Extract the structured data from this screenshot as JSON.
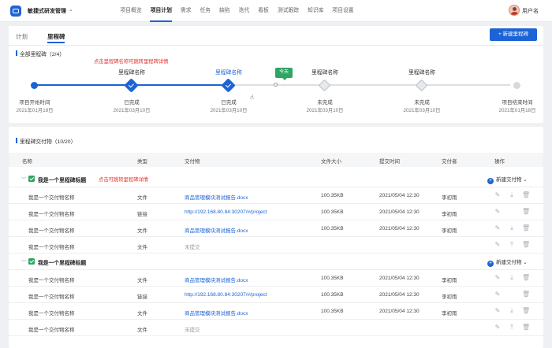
{
  "app": {
    "title": "敏捷式研发管理",
    "username": "用户名"
  },
  "nav": [
    "项目概览",
    "项目计划",
    "需求",
    "任务",
    "缺陷",
    "迭代",
    "看板",
    "测试跟踪",
    "知识库",
    "项目设置"
  ],
  "tabs": {
    "plan": "计划",
    "milestone": "里程碑"
  },
  "new_milestone_button": "+ 新建里程碑",
  "milestones_section": {
    "title": "全部里程碑（2/4）",
    "annotation": "点击里程碑名称可跳转里程碑详情",
    "today_label": "今天",
    "nodes": [
      {
        "name": "",
        "status": "项目开始时间",
        "date": "2021年01月18日"
      },
      {
        "name": "里程碑名称",
        "status": "已完成",
        "date": "2021年03月10日"
      },
      {
        "name": "里程碑名称",
        "status": "已完成",
        "date": "2021年03月10日"
      },
      {
        "name": "里程碑名称",
        "status": "未完成",
        "date": "2021年03月10日"
      },
      {
        "name": "里程碑名称",
        "status": "未完成",
        "date": "2021年03月10日"
      },
      {
        "name": "",
        "status": "项目结束时间",
        "date": "2021年01月18日"
      }
    ]
  },
  "deliverables_section": {
    "title": "里程碑交付物（10/20）",
    "columns": [
      "名称",
      "类型",
      "交付物",
      "文件大小",
      "提交时间",
      "交付者",
      "操作"
    ],
    "group_annotation": "点击可跳转里程碑详情",
    "new_deliverable": "新建交付物",
    "groups": [
      {
        "title": "我是一个里程碑标题",
        "rows": [
          {
            "name": "我是一个交付物名称",
            "type": "文件",
            "item": "商品管理模块测试报告.docx",
            "size": "100.35KB",
            "time": "2021/05/04 12:30",
            "by": "李初雨"
          },
          {
            "name": "我是一个交付物名称",
            "type": "链接",
            "item": "http://192.168.80.84:30207/#/project",
            "size": "100.35KB",
            "time": "2021/05/04 12:30",
            "by": "李初雨"
          },
          {
            "name": "我是一个交付物名称",
            "type": "文件",
            "item": "商品管理模块测试报告.docx",
            "size": "100.35KB",
            "time": "2021/05/04 12:30",
            "by": "李初雨"
          },
          {
            "name": "我是一个交付物名称",
            "type": "文件",
            "item": "未提交",
            "size": "",
            "time": "",
            "by": ""
          }
        ]
      },
      {
        "title": "我是一个里程碑标题",
        "rows": [
          {
            "name": "我是一个交付物名称",
            "type": "文件",
            "item": "商品管理模块测试报告.docx",
            "size": "100.35KB",
            "time": "2021/05/04 12:30",
            "by": "李初雨"
          },
          {
            "name": "我是一个交付物名称",
            "type": "链接",
            "item": "http://192.168.80.84:30207/#/project",
            "size": "100.35KB",
            "time": "2021/05/04 12:30",
            "by": "李初雨"
          },
          {
            "name": "我是一个交付物名称",
            "type": "文件",
            "item": "商品管理模块测试报告.docx",
            "size": "100.35KB",
            "time": "2021/05/04 12:30",
            "by": "李初雨"
          },
          {
            "name": "我是一个交付物名称",
            "type": "文件",
            "item": "未提交",
            "size": "",
            "time": "",
            "by": ""
          }
        ]
      }
    ]
  }
}
